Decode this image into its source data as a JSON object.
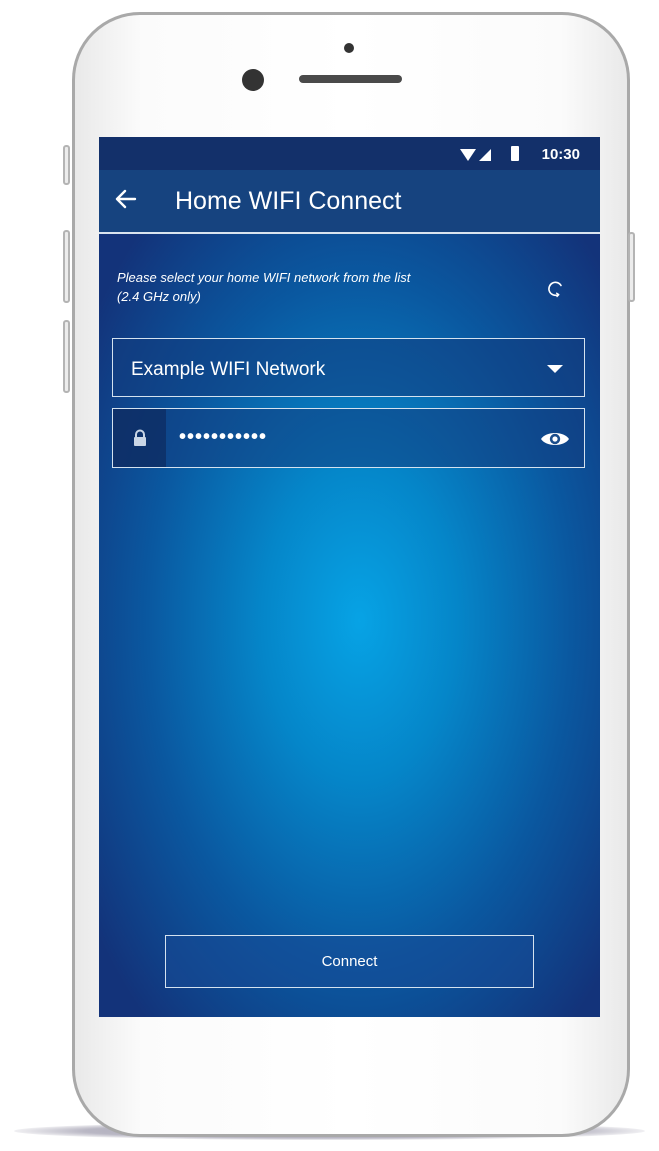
{
  "status_bar": {
    "time": "10:30",
    "icons": [
      "wifi-icon",
      "cell-signal-icon",
      "battery-icon"
    ]
  },
  "app_bar": {
    "back_icon": "arrow-left-icon",
    "title": "Home WIFI Connect"
  },
  "form": {
    "hint_line1": "Please select your home WIFI network from the list",
    "hint_line2": "(2.4 GHz only)",
    "refresh_icon": "refresh-icon",
    "network_select": {
      "selected": "Example WIFI Network",
      "icon": "caret-down-icon"
    },
    "password": {
      "value": "•••••••••••",
      "lock_icon": "lock-icon",
      "toggle_icon": "eye-icon"
    },
    "connect_label": "Connect"
  },
  "colors": {
    "status_bar": "#13306a",
    "app_bar": "#16437f",
    "gradient_center": "#07a3e5",
    "gradient_edge": "#13337a",
    "text": "#ffffff"
  }
}
